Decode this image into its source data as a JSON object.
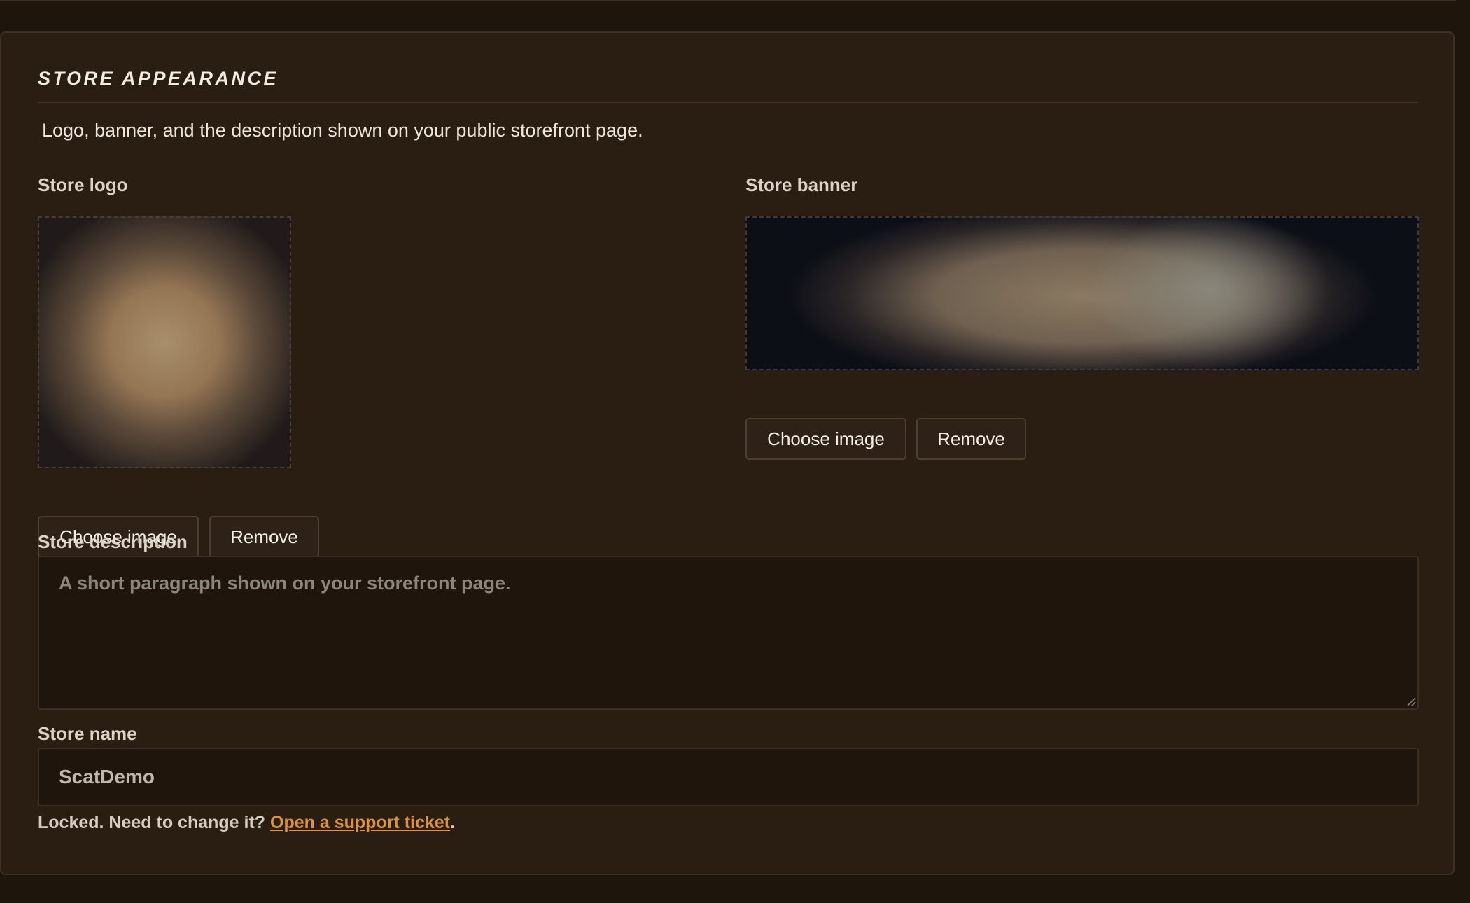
{
  "section": {
    "title": "STORE APPEARANCE",
    "description": "Logo, banner, and the description shown on your public storefront page."
  },
  "logo": {
    "label": "Store logo",
    "choose_label": "Choose image",
    "remove_label": "Remove"
  },
  "banner": {
    "label": "Store banner",
    "choose_label": "Choose image",
    "remove_label": "Remove"
  },
  "description_field": {
    "label": "Store description",
    "value": "",
    "placeholder": "A short paragraph shown on your storefront page."
  },
  "name_field": {
    "label": "Store name",
    "value": "ScatDemo",
    "help_prefix": "Locked. Need to change it?",
    "help_link": "Open a support ticket",
    "help_suffix": "."
  },
  "colors": {
    "background": "#2a1d12",
    "accent_link": "#d99342"
  }
}
